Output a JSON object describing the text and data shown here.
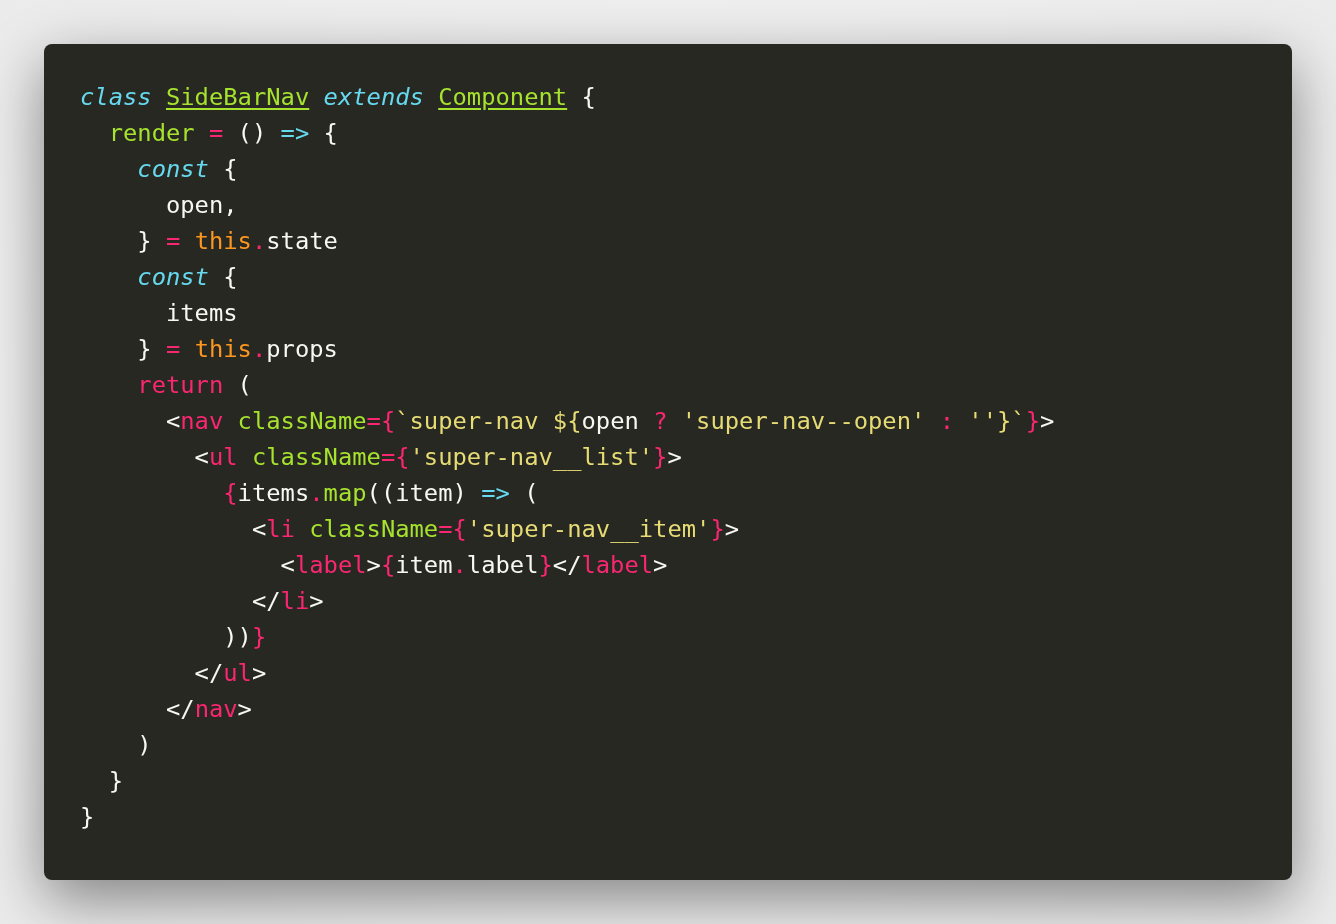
{
  "code_lines": [
    {
      "tokens": [
        {
          "text": "class ",
          "kind": "keyword"
        },
        {
          "text": "SideBarNav",
          "kind": "type"
        },
        {
          "text": " extends ",
          "kind": "keyword"
        },
        {
          "text": "Component",
          "kind": "type"
        },
        {
          "text": " {",
          "kind": "plain"
        }
      ]
    },
    {
      "tokens": [
        {
          "text": "  render ",
          "kind": "function"
        },
        {
          "text": "=",
          "kind": "operator"
        },
        {
          "text": " () ",
          "kind": "plain"
        },
        {
          "text": "=>",
          "kind": "arrow"
        },
        {
          "text": " {",
          "kind": "plain"
        }
      ]
    },
    {
      "tokens": [
        {
          "text": "    const",
          "kind": "keyword"
        },
        {
          "text": " {",
          "kind": "plain"
        }
      ]
    },
    {
      "tokens": [
        {
          "text": "      open,",
          "kind": "plain"
        }
      ]
    },
    {
      "tokens": [
        {
          "text": "    } ",
          "kind": "plain"
        },
        {
          "text": "= ",
          "kind": "operator"
        },
        {
          "text": "this",
          "kind": "this"
        },
        {
          "text": ".",
          "kind": "operator"
        },
        {
          "text": "state",
          "kind": "plain"
        }
      ]
    },
    {
      "tokens": [
        {
          "text": "    const",
          "kind": "keyword"
        },
        {
          "text": " {",
          "kind": "plain"
        }
      ]
    },
    {
      "tokens": [
        {
          "text": "      items",
          "kind": "plain"
        }
      ]
    },
    {
      "tokens": [
        {
          "text": "    } ",
          "kind": "plain"
        },
        {
          "text": "= ",
          "kind": "operator"
        },
        {
          "text": "this",
          "kind": "this"
        },
        {
          "text": ".",
          "kind": "operator"
        },
        {
          "text": "props",
          "kind": "plain"
        }
      ]
    },
    {
      "tokens": [
        {
          "text": "    return",
          "kind": "operator"
        },
        {
          "text": " (",
          "kind": "plain"
        }
      ]
    },
    {
      "tokens": [
        {
          "text": "      <",
          "kind": "plain"
        },
        {
          "text": "nav ",
          "kind": "operator"
        },
        {
          "text": "className",
          "kind": "function"
        },
        {
          "text": "={",
          "kind": "operator"
        },
        {
          "text": "`super-nav ${",
          "kind": "string"
        },
        {
          "text": "open ",
          "kind": "plain"
        },
        {
          "text": "? ",
          "kind": "operator"
        },
        {
          "text": "'super-nav--open' ",
          "kind": "string"
        },
        {
          "text": ": ",
          "kind": "operator"
        },
        {
          "text": "''}`",
          "kind": "string"
        },
        {
          "text": "}",
          "kind": "operator"
        },
        {
          "text": ">",
          "kind": "plain"
        }
      ]
    },
    {
      "tokens": [
        {
          "text": "        <",
          "kind": "plain"
        },
        {
          "text": "ul ",
          "kind": "operator"
        },
        {
          "text": "className",
          "kind": "function"
        },
        {
          "text": "={",
          "kind": "operator"
        },
        {
          "text": "'super-nav__list'",
          "kind": "string"
        },
        {
          "text": "}",
          "kind": "operator"
        },
        {
          "text": ">",
          "kind": "plain"
        }
      ]
    },
    {
      "tokens": [
        {
          "text": "          {",
          "kind": "operator"
        },
        {
          "text": "items",
          "kind": "plain"
        },
        {
          "text": ".",
          "kind": "operator"
        },
        {
          "text": "map",
          "kind": "function"
        },
        {
          "text": "((item) ",
          "kind": "plain"
        },
        {
          "text": "=>",
          "kind": "arrow"
        },
        {
          "text": " (",
          "kind": "plain"
        }
      ]
    },
    {
      "tokens": [
        {
          "text": "            <",
          "kind": "plain"
        },
        {
          "text": "li ",
          "kind": "operator"
        },
        {
          "text": "className",
          "kind": "function"
        },
        {
          "text": "={",
          "kind": "operator"
        },
        {
          "text": "'super-nav__item'",
          "kind": "string"
        },
        {
          "text": "}",
          "kind": "operator"
        },
        {
          "text": ">",
          "kind": "plain"
        }
      ]
    },
    {
      "tokens": [
        {
          "text": "              <",
          "kind": "plain"
        },
        {
          "text": "label",
          "kind": "operator"
        },
        {
          "text": ">",
          "kind": "plain"
        },
        {
          "text": "{",
          "kind": "operator"
        },
        {
          "text": "item",
          "kind": "plain"
        },
        {
          "text": ".",
          "kind": "operator"
        },
        {
          "text": "label",
          "kind": "plain"
        },
        {
          "text": "}",
          "kind": "operator"
        },
        {
          "text": "</",
          "kind": "plain"
        },
        {
          "text": "label",
          "kind": "operator"
        },
        {
          "text": ">",
          "kind": "plain"
        }
      ]
    },
    {
      "tokens": [
        {
          "text": "            </",
          "kind": "plain"
        },
        {
          "text": "li",
          "kind": "operator"
        },
        {
          "text": ">",
          "kind": "plain"
        }
      ]
    },
    {
      "tokens": [
        {
          "text": "          ))",
          "kind": "plain"
        },
        {
          "text": "}",
          "kind": "operator"
        }
      ]
    },
    {
      "tokens": [
        {
          "text": "        </",
          "kind": "plain"
        },
        {
          "text": "ul",
          "kind": "operator"
        },
        {
          "text": ">",
          "kind": "plain"
        }
      ]
    },
    {
      "tokens": [
        {
          "text": "      </",
          "kind": "plain"
        },
        {
          "text": "nav",
          "kind": "operator"
        },
        {
          "text": ">",
          "kind": "plain"
        }
      ]
    },
    {
      "tokens": [
        {
          "text": "    )",
          "kind": "plain"
        }
      ]
    },
    {
      "tokens": [
        {
          "text": "  }",
          "kind": "plain"
        }
      ]
    },
    {
      "tokens": [
        {
          "text": "}",
          "kind": "plain"
        }
      ]
    }
  ]
}
